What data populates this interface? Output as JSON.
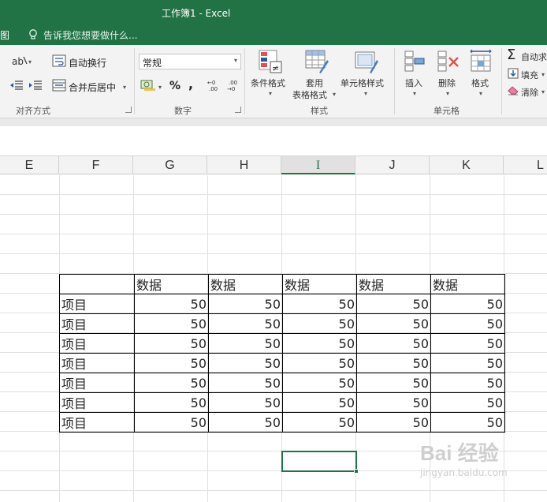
{
  "window": {
    "title": "工作簿1 - Excel"
  },
  "menubar": {
    "tab_partial": "图",
    "tell_me_placeholder": "告诉我您想要做什么..."
  },
  "ribbon": {
    "alignment": {
      "label": "对齐方式",
      "wrap_text": "自动换行",
      "merge_center": "合并后居中"
    },
    "number": {
      "label": "数字",
      "format_value": "常规",
      "percent": "%",
      "comma": ","
    },
    "styles": {
      "label": "样式",
      "conditional_format": "条件格式",
      "table_format_line1": "套用",
      "table_format_line2": "表格格式",
      "cell_styles": "单元格样式"
    },
    "cells": {
      "label": "单元格",
      "insert": "插入",
      "delete": "删除",
      "format": "格式"
    },
    "editing": {
      "autosum": "自动求",
      "fill": "填充",
      "clear": "清除"
    }
  },
  "columns": [
    "E",
    "F",
    "G",
    "H",
    "I",
    "J",
    "K",
    "L"
  ],
  "active_column": "I",
  "table": {
    "header": [
      "",
      "数据",
      "数据",
      "数据",
      "数据",
      "数据"
    ],
    "rows": [
      [
        "项目",
        "50",
        "50",
        "50",
        "50",
        "50"
      ],
      [
        "项目",
        "50",
        "50",
        "50",
        "50",
        "50"
      ],
      [
        "项目",
        "50",
        "50",
        "50",
        "50",
        "50"
      ],
      [
        "项目",
        "50",
        "50",
        "50",
        "50",
        "50"
      ],
      [
        "项目",
        "50",
        "50",
        "50",
        "50",
        "50"
      ],
      [
        "项目",
        "50",
        "50",
        "50",
        "50",
        "50"
      ],
      [
        "项目",
        "50",
        "50",
        "50",
        "50",
        "50"
      ]
    ]
  },
  "watermark": {
    "logo": "Bai 经验",
    "url": "jingyan.baidu.com"
  },
  "colors": {
    "brand": "#217346",
    "ribbon_bg": "#f3f3f3",
    "grid": "#e0e0e0"
  }
}
